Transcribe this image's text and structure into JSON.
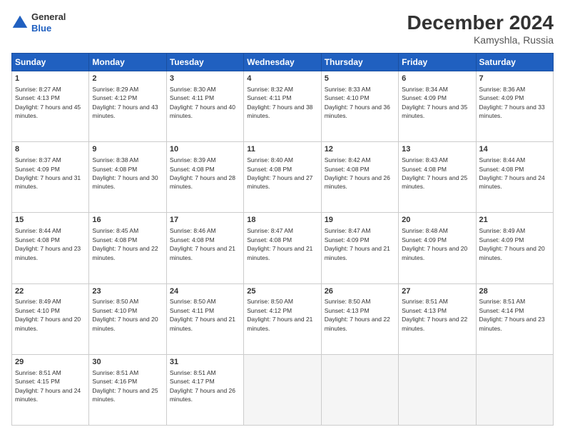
{
  "header": {
    "logo_general": "General",
    "logo_blue": "Blue",
    "title": "December 2024",
    "location": "Kamyshla, Russia"
  },
  "weekdays": [
    "Sunday",
    "Monday",
    "Tuesday",
    "Wednesday",
    "Thursday",
    "Friday",
    "Saturday"
  ],
  "weeks": [
    [
      {
        "day": "1",
        "sunrise": "Sunrise: 8:27 AM",
        "sunset": "Sunset: 4:13 PM",
        "daylight": "Daylight: 7 hours and 45 minutes."
      },
      {
        "day": "2",
        "sunrise": "Sunrise: 8:29 AM",
        "sunset": "Sunset: 4:12 PM",
        "daylight": "Daylight: 7 hours and 43 minutes."
      },
      {
        "day": "3",
        "sunrise": "Sunrise: 8:30 AM",
        "sunset": "Sunset: 4:11 PM",
        "daylight": "Daylight: 7 hours and 40 minutes."
      },
      {
        "day": "4",
        "sunrise": "Sunrise: 8:32 AM",
        "sunset": "Sunset: 4:11 PM",
        "daylight": "Daylight: 7 hours and 38 minutes."
      },
      {
        "day": "5",
        "sunrise": "Sunrise: 8:33 AM",
        "sunset": "Sunset: 4:10 PM",
        "daylight": "Daylight: 7 hours and 36 minutes."
      },
      {
        "day": "6",
        "sunrise": "Sunrise: 8:34 AM",
        "sunset": "Sunset: 4:09 PM",
        "daylight": "Daylight: 7 hours and 35 minutes."
      },
      {
        "day": "7",
        "sunrise": "Sunrise: 8:36 AM",
        "sunset": "Sunset: 4:09 PM",
        "daylight": "Daylight: 7 hours and 33 minutes."
      }
    ],
    [
      {
        "day": "8",
        "sunrise": "Sunrise: 8:37 AM",
        "sunset": "Sunset: 4:09 PM",
        "daylight": "Daylight: 7 hours and 31 minutes."
      },
      {
        "day": "9",
        "sunrise": "Sunrise: 8:38 AM",
        "sunset": "Sunset: 4:08 PM",
        "daylight": "Daylight: 7 hours and 30 minutes."
      },
      {
        "day": "10",
        "sunrise": "Sunrise: 8:39 AM",
        "sunset": "Sunset: 4:08 PM",
        "daylight": "Daylight: 7 hours and 28 minutes."
      },
      {
        "day": "11",
        "sunrise": "Sunrise: 8:40 AM",
        "sunset": "Sunset: 4:08 PM",
        "daylight": "Daylight: 7 hours and 27 minutes."
      },
      {
        "day": "12",
        "sunrise": "Sunrise: 8:42 AM",
        "sunset": "Sunset: 4:08 PM",
        "daylight": "Daylight: 7 hours and 26 minutes."
      },
      {
        "day": "13",
        "sunrise": "Sunrise: 8:43 AM",
        "sunset": "Sunset: 4:08 PM",
        "daylight": "Daylight: 7 hours and 25 minutes."
      },
      {
        "day": "14",
        "sunrise": "Sunrise: 8:44 AM",
        "sunset": "Sunset: 4:08 PM",
        "daylight": "Daylight: 7 hours and 24 minutes."
      }
    ],
    [
      {
        "day": "15",
        "sunrise": "Sunrise: 8:44 AM",
        "sunset": "Sunset: 4:08 PM",
        "daylight": "Daylight: 7 hours and 23 minutes."
      },
      {
        "day": "16",
        "sunrise": "Sunrise: 8:45 AM",
        "sunset": "Sunset: 4:08 PM",
        "daylight": "Daylight: 7 hours and 22 minutes."
      },
      {
        "day": "17",
        "sunrise": "Sunrise: 8:46 AM",
        "sunset": "Sunset: 4:08 PM",
        "daylight": "Daylight: 7 hours and 21 minutes."
      },
      {
        "day": "18",
        "sunrise": "Sunrise: 8:47 AM",
        "sunset": "Sunset: 4:08 PM",
        "daylight": "Daylight: 7 hours and 21 minutes."
      },
      {
        "day": "19",
        "sunrise": "Sunrise: 8:47 AM",
        "sunset": "Sunset: 4:09 PM",
        "daylight": "Daylight: 7 hours and 21 minutes."
      },
      {
        "day": "20",
        "sunrise": "Sunrise: 8:48 AM",
        "sunset": "Sunset: 4:09 PM",
        "daylight": "Daylight: 7 hours and 20 minutes."
      },
      {
        "day": "21",
        "sunrise": "Sunrise: 8:49 AM",
        "sunset": "Sunset: 4:09 PM",
        "daylight": "Daylight: 7 hours and 20 minutes."
      }
    ],
    [
      {
        "day": "22",
        "sunrise": "Sunrise: 8:49 AM",
        "sunset": "Sunset: 4:10 PM",
        "daylight": "Daylight: 7 hours and 20 minutes."
      },
      {
        "day": "23",
        "sunrise": "Sunrise: 8:50 AM",
        "sunset": "Sunset: 4:10 PM",
        "daylight": "Daylight: 7 hours and 20 minutes."
      },
      {
        "day": "24",
        "sunrise": "Sunrise: 8:50 AM",
        "sunset": "Sunset: 4:11 PM",
        "daylight": "Daylight: 7 hours and 21 minutes."
      },
      {
        "day": "25",
        "sunrise": "Sunrise: 8:50 AM",
        "sunset": "Sunset: 4:12 PM",
        "daylight": "Daylight: 7 hours and 21 minutes."
      },
      {
        "day": "26",
        "sunrise": "Sunrise: 8:50 AM",
        "sunset": "Sunset: 4:13 PM",
        "daylight": "Daylight: 7 hours and 22 minutes."
      },
      {
        "day": "27",
        "sunrise": "Sunrise: 8:51 AM",
        "sunset": "Sunset: 4:13 PM",
        "daylight": "Daylight: 7 hours and 22 minutes."
      },
      {
        "day": "28",
        "sunrise": "Sunrise: 8:51 AM",
        "sunset": "Sunset: 4:14 PM",
        "daylight": "Daylight: 7 hours and 23 minutes."
      }
    ],
    [
      {
        "day": "29",
        "sunrise": "Sunrise: 8:51 AM",
        "sunset": "Sunset: 4:15 PM",
        "daylight": "Daylight: 7 hours and 24 minutes."
      },
      {
        "day": "30",
        "sunrise": "Sunrise: 8:51 AM",
        "sunset": "Sunset: 4:16 PM",
        "daylight": "Daylight: 7 hours and 25 minutes."
      },
      {
        "day": "31",
        "sunrise": "Sunrise: 8:51 AM",
        "sunset": "Sunset: 4:17 PM",
        "daylight": "Daylight: 7 hours and 26 minutes."
      },
      null,
      null,
      null,
      null
    ]
  ]
}
